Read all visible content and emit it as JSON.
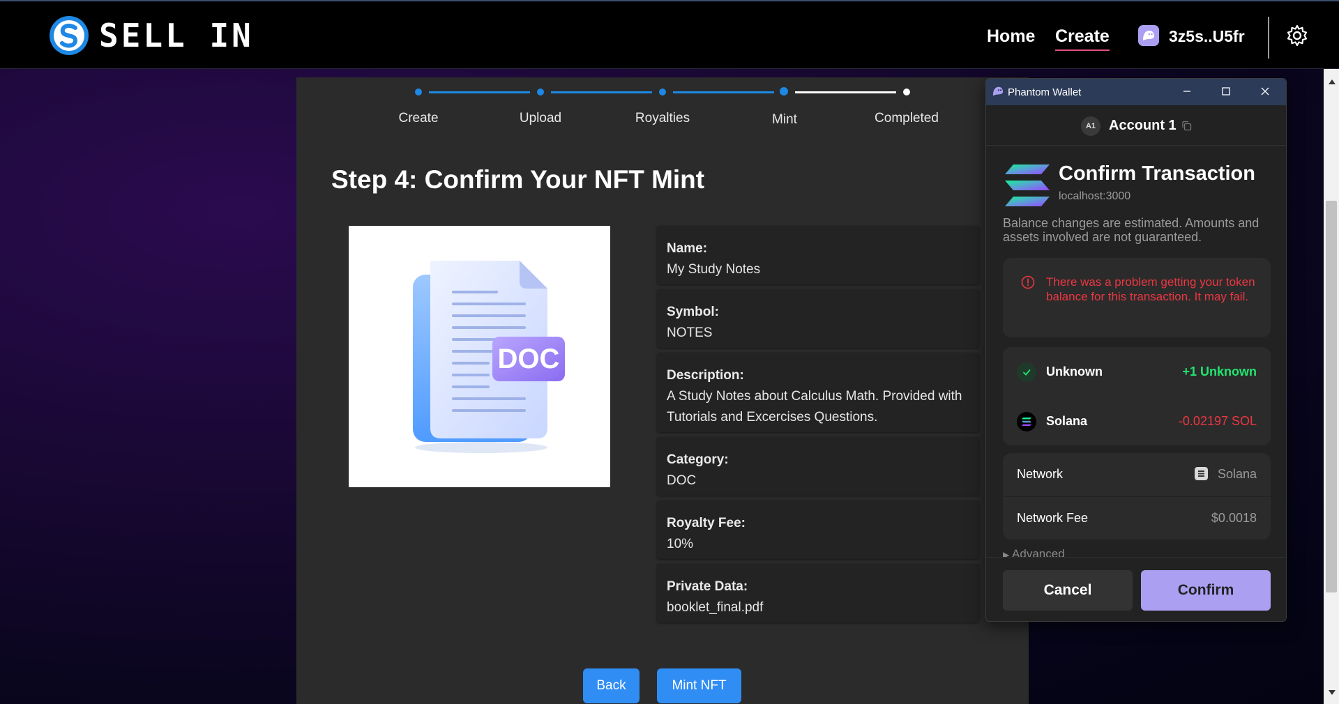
{
  "header": {
    "brand": "SELL IN",
    "nav": {
      "home": "Home",
      "create": "Create"
    },
    "wallet_address": "3z5s..U5fr",
    "icons": {
      "logo": "sell-in-logo",
      "wallet": "phantom-ghost-icon",
      "settings": "gear-icon"
    }
  },
  "stepper": {
    "steps": [
      {
        "label": "Create",
        "status": "done"
      },
      {
        "label": "Upload",
        "status": "done"
      },
      {
        "label": "Royalties",
        "status": "done"
      },
      {
        "label": "Mint",
        "status": "current"
      },
      {
        "label": "Completed",
        "status": "pending"
      }
    ]
  },
  "main": {
    "title": "Step 4: Confirm Your NFT Mint",
    "preview_badge": "DOC",
    "details": [
      {
        "label": "Name:",
        "value": "My Study Notes"
      },
      {
        "label": "Symbol:",
        "value": "NOTES"
      },
      {
        "label": "Description:",
        "value": "A Study Notes about Calculus Math. Provided with Tutorials and Excercises Questions."
      },
      {
        "label": "Category:",
        "value": "DOC"
      },
      {
        "label": "Royalty Fee:",
        "value": "10%"
      },
      {
        "label": "Private Data:",
        "value": "booklet_final.pdf"
      }
    ],
    "buttons": {
      "back": "Back",
      "mint": "Mint NFT"
    }
  },
  "phantom": {
    "window_title": "Phantom Wallet",
    "account_badge": "A1",
    "account_name": "Account 1",
    "heading": "Confirm Transaction",
    "origin": "localhost:3000",
    "note": "Balance changes are estimated. Amounts and assets involved are not guaranteed.",
    "warning": "There was a problem getting your token balance for this transaction. It may fail.",
    "changes": [
      {
        "name": "Unknown",
        "amount": "+1 Unknown",
        "kind": "positive"
      },
      {
        "name": "Solana",
        "amount": "-0.02197 SOL",
        "kind": "negative"
      }
    ],
    "network": {
      "label": "Network",
      "value": "Solana"
    },
    "fee": {
      "label": "Network Fee",
      "value": "$0.0018"
    },
    "advanced": "Advanced",
    "cancel": "Cancel",
    "confirm": "Confirm"
  },
  "colors": {
    "accent_blue": "#2f8df4",
    "phantom_purple": "#ab9ff2",
    "error_red": "#eb3742",
    "success_green": "#21e56f",
    "nav_underline": "#e0517f"
  }
}
